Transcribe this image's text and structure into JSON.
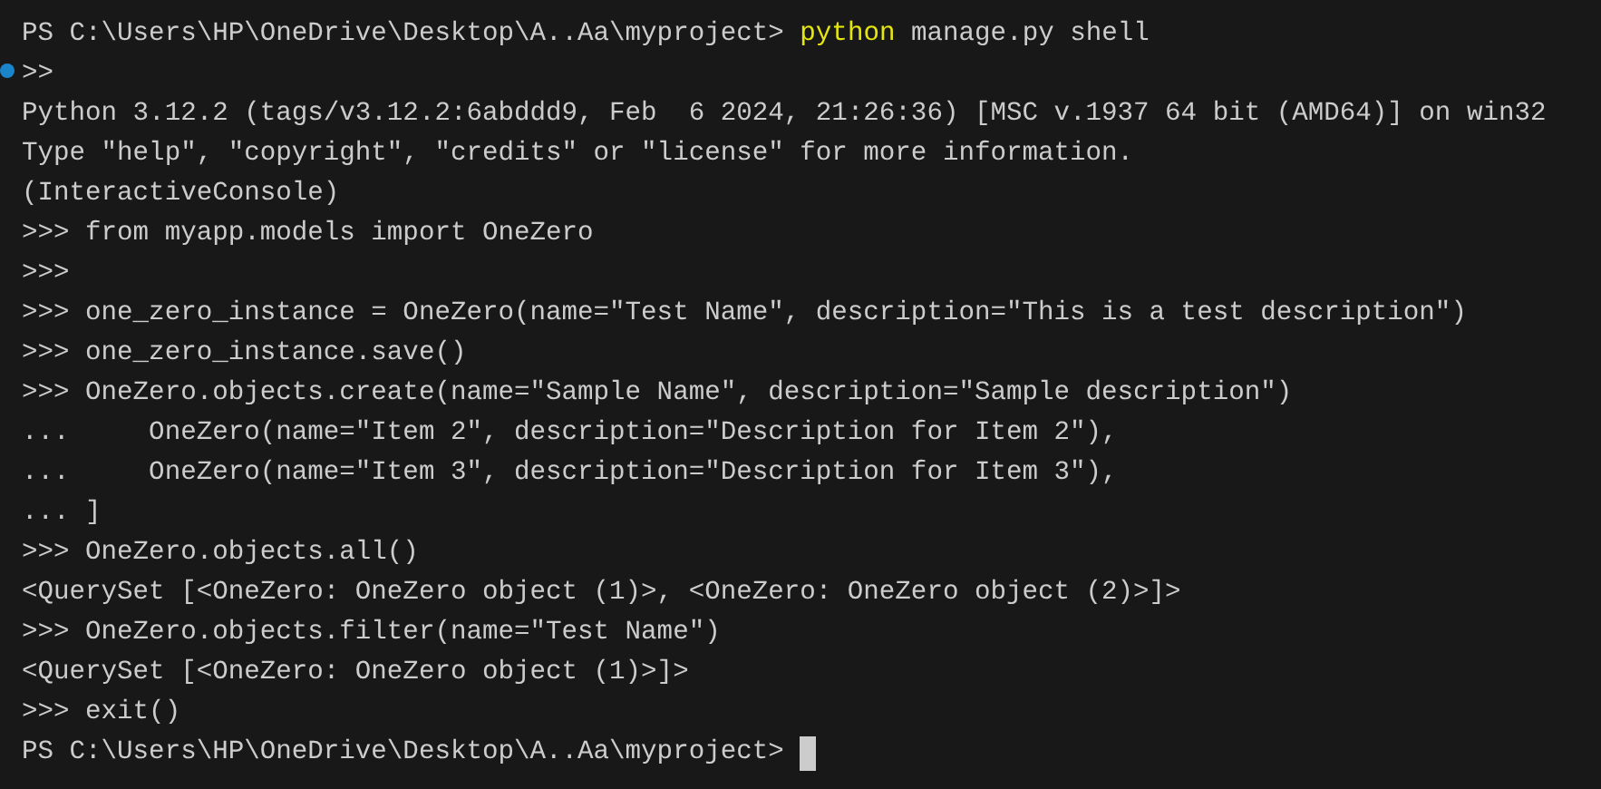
{
  "terminal": {
    "lines": [
      {
        "kind": "command",
        "prompt": "PS C:\\Users\\HP\\OneDrive\\Desktop\\A..Aa\\myproject>",
        "command": "python",
        "args": "manage.py shell"
      },
      {
        "kind": "text",
        "text": ">>",
        "marker": true
      },
      {
        "kind": "text",
        "text": "Python 3.12.2 (tags/v3.12.2:6abddd9, Feb  6 2024, 21:26:36) [MSC v.1937 64 bit (AMD64)] on win32"
      },
      {
        "kind": "text",
        "text": "Type \"help\", \"copyright\", \"credits\" or \"license\" for more information."
      },
      {
        "kind": "text",
        "text": "(InteractiveConsole)"
      },
      {
        "kind": "text",
        "text": ">>> from myapp.models import OneZero"
      },
      {
        "kind": "text",
        "text": ">>>"
      },
      {
        "kind": "text",
        "text": ">>> one_zero_instance = OneZero(name=\"Test Name\", description=\"This is a test description\")"
      },
      {
        "kind": "text",
        "text": ">>> one_zero_instance.save()"
      },
      {
        "kind": "text",
        "text": ">>> OneZero.objects.create(name=\"Sample Name\", description=\"Sample description\")"
      },
      {
        "kind": "text",
        "text": "...     OneZero(name=\"Item 2\", description=\"Description for Item 2\"),"
      },
      {
        "kind": "text",
        "text": "...     OneZero(name=\"Item 3\", description=\"Description for Item 3\"),"
      },
      {
        "kind": "text",
        "text": "... ]"
      },
      {
        "kind": "text",
        "text": ">>> OneZero.objects.all()"
      },
      {
        "kind": "text",
        "text": "<QuerySet [<OneZero: OneZero object (1)>, <OneZero: OneZero object (2)>]>"
      },
      {
        "kind": "text",
        "text": ">>> OneZero.objects.filter(name=\"Test Name\")"
      },
      {
        "kind": "text",
        "text": "<QuerySet [<OneZero: OneZero object (1)>]>"
      },
      {
        "kind": "text",
        "text": ">>> exit()"
      },
      {
        "kind": "prompt",
        "prompt": "PS C:\\Users\\HP\\OneDrive\\Desktop\\A..Aa\\myproject>",
        "cursor": true
      }
    ]
  }
}
